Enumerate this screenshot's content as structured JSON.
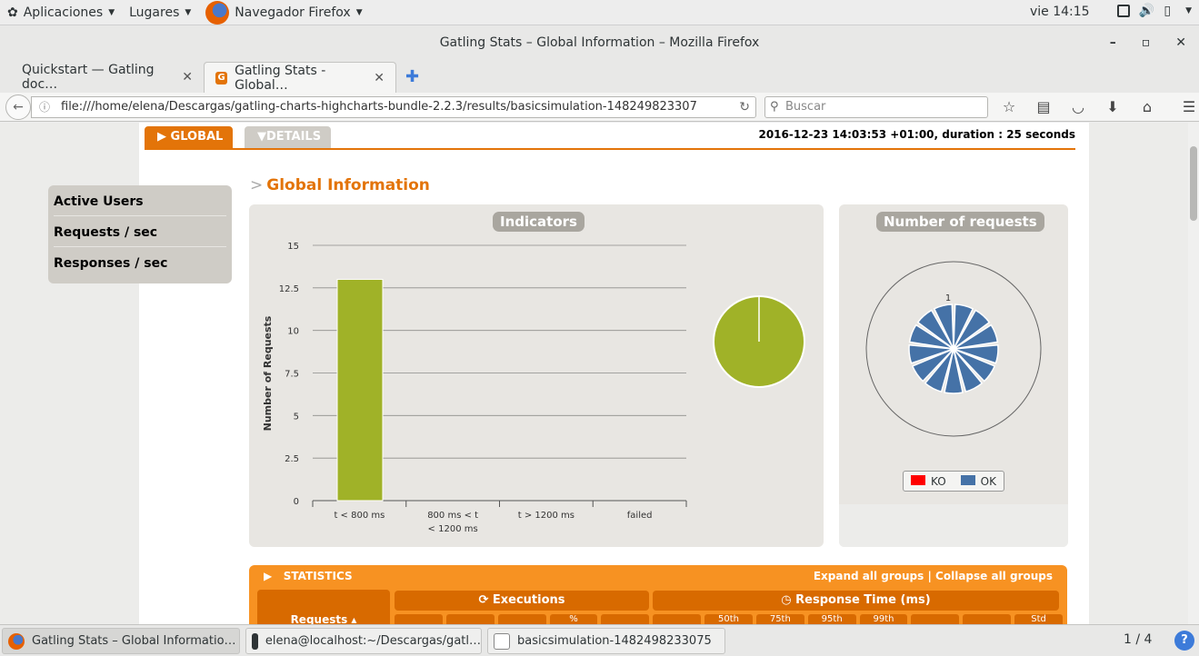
{
  "topbar": {
    "apps_menu": "Aplicaciones",
    "places_menu": "Lugares",
    "app_menu": "Navegador Firefox",
    "clock": "vie 14:15"
  },
  "window": {
    "title": "Gatling Stats – Global Information – Mozilla Firefox",
    "minimize": "–",
    "maximize": "▫",
    "close": "✕"
  },
  "tabs": [
    {
      "label": "Quickstart — Gatling doc…"
    },
    {
      "label": "Gatling Stats - Global…"
    }
  ],
  "navbar": {
    "url": "file:///home/elena/Descargas/gatling-charts-highcharts-bundle-2.2.3/results/basicsimulation-148249823307",
    "search_placeholder": "Buscar"
  },
  "report": {
    "tab_global": "GLOBAL",
    "tab_details": "DETAILS",
    "run_info": "2016-12-23 14:03:53 +01:00, duration : 25 seconds",
    "section_title": "Global Information",
    "side_menu": [
      "Active Users",
      "Requests / sec",
      "Responses / sec"
    ],
    "indicators_title": "Indicators",
    "number_title": "Number of requests",
    "legend": [
      {
        "name": "KO",
        "color": "#ff0000"
      },
      {
        "name": "OK",
        "color": "#4572a7"
      }
    ],
    "statistics": {
      "header": "STATISTICS",
      "expand": "Expand all groups",
      "separator": " | ",
      "collapse": "Collapse all groups",
      "requests": "Requests ▴",
      "executions": "Executions",
      "response_time": "Response Time (ms)",
      "sub_headers": [
        "",
        "",
        "",
        "%",
        "",
        "",
        "50th",
        "75th",
        "95th",
        "99th",
        "",
        "",
        "Std"
      ]
    }
  },
  "chart_data": [
    {
      "type": "bar",
      "title": "Indicators",
      "categories": [
        "t < 800 ms",
        "800 ms < t < 1200 ms",
        "t > 1200 ms",
        "failed"
      ],
      "values": [
        13,
        0,
        0,
        0
      ],
      "ylabel": "Number of Requests",
      "ylim": [
        0,
        15
      ],
      "yticks": [
        "0",
        "2.5",
        "5",
        "7.5",
        "10",
        "12.5",
        "15"
      ],
      "color": "#a0b228",
      "grid": true
    },
    {
      "type": "pie",
      "values": [
        100
      ],
      "color": "#a0b228"
    },
    {
      "type": "pie",
      "title": "Number of requests",
      "slices": 13,
      "slice_value": 1,
      "top_label": "1",
      "color": "#4572a7"
    }
  ],
  "taskbar": {
    "items": [
      "Gatling Stats – Global Informatio…",
      "elena@localhost:~/Descargas/gatl…",
      "basicsimulation-1482498233075"
    ],
    "pager": "1 / 4",
    "help": "?"
  }
}
